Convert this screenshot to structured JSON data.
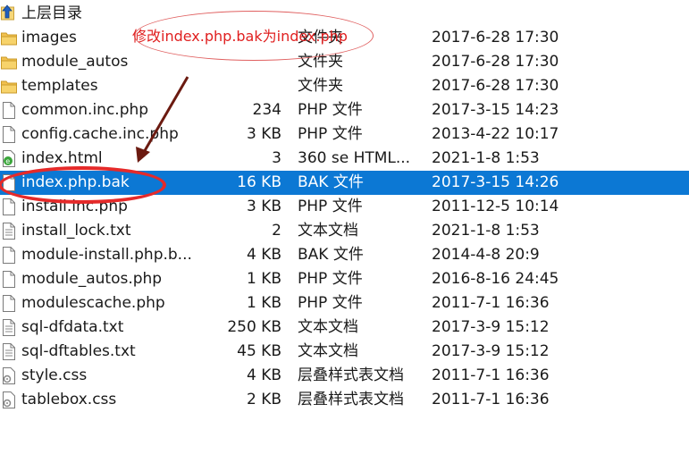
{
  "up_folder": {
    "label": "上层目录",
    "icon": "folder-up-icon"
  },
  "files": [
    {
      "name": "images",
      "size": "",
      "type": "文件夹",
      "date": "2017-6-28 17:30",
      "icon": "folder-icon"
    },
    {
      "name": "module_autos",
      "size": "",
      "type": "文件夹",
      "date": "2017-6-28 17:30",
      "icon": "folder-icon"
    },
    {
      "name": "templates",
      "size": "",
      "type": "文件夹",
      "date": "2017-6-28 17:30",
      "icon": "folder-icon"
    },
    {
      "name": "common.inc.php",
      "size": "234",
      "type": "PHP 文件",
      "date": "2017-3-15 14:23",
      "icon": "file-icon"
    },
    {
      "name": "config.cache.inc.php",
      "size": "3 KB",
      "type": "PHP 文件",
      "date": "2013-4-22 10:17",
      "icon": "file-icon"
    },
    {
      "name": "index.html",
      "size": "3",
      "type": "360 se HTML...",
      "date": "2021-1-8 1:53",
      "icon": "html-file-icon"
    },
    {
      "name": "index.php.bak",
      "size": "16 KB",
      "type": "BAK 文件",
      "date": "2017-3-15 14:26",
      "icon": "file-icon",
      "selected": true
    },
    {
      "name": "install.inc.php",
      "size": "3 KB",
      "type": "PHP 文件",
      "date": "2011-12-5 10:14",
      "icon": "file-icon"
    },
    {
      "name": "install_lock.txt",
      "size": "2",
      "type": "文本文档",
      "date": "2021-1-8 1:53",
      "icon": "text-file-icon"
    },
    {
      "name": "module-install.php.b...",
      "size": "4 KB",
      "type": "BAK 文件",
      "date": "2014-4-8 20:9",
      "icon": "file-icon"
    },
    {
      "name": "module_autos.php",
      "size": "1 KB",
      "type": "PHP 文件",
      "date": "2016-8-16 24:45",
      "icon": "file-icon"
    },
    {
      "name": "modulescache.php",
      "size": "1 KB",
      "type": "PHP 文件",
      "date": "2011-7-1 16:36",
      "icon": "file-icon"
    },
    {
      "name": "sql-dfdata.txt",
      "size": "250 KB",
      "type": "文本文档",
      "date": "2017-3-9 15:12",
      "icon": "text-file-icon"
    },
    {
      "name": "sql-dftables.txt",
      "size": "45 KB",
      "type": "文本文档",
      "date": "2017-3-9 15:12",
      "icon": "text-file-icon"
    },
    {
      "name": "style.css",
      "size": "4 KB",
      "type": "层叠样式表文档",
      "date": "2011-7-1 16:36",
      "icon": "css-file-icon"
    },
    {
      "name": "tablebox.css",
      "size": "2 KB",
      "type": "层叠样式表文档",
      "date": "2011-7-1 16:36",
      "icon": "css-file-icon"
    }
  ],
  "annotation": {
    "text": "修改index.php.bak为index.php",
    "color": "#e02020"
  },
  "colors": {
    "selection": "#0c78d4",
    "folder": "#f2c14e"
  }
}
